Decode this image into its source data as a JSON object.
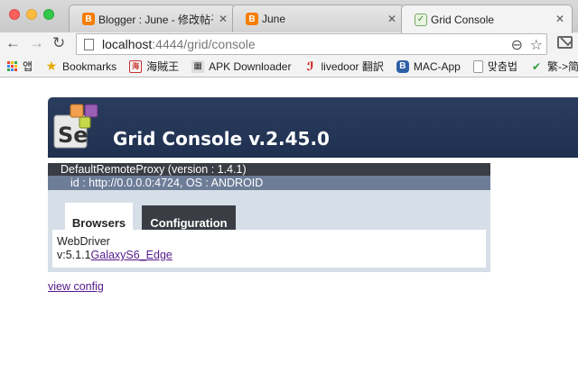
{
  "browser": {
    "tabs": [
      {
        "label": "Blogger : June - 修改帖子",
        "favicon": "blogger-icon"
      },
      {
        "label": "June",
        "favicon": "blogger-icon"
      },
      {
        "label": "Grid Console",
        "favicon": "grid-console-icon",
        "active": true
      }
    ],
    "url_host": "localhost",
    "url_path": ":4444/grid/console",
    "bookmarks": [
      {
        "label": "앱",
        "icon": "apps-icon"
      },
      {
        "label": "Bookmarks",
        "icon": "star-icon"
      },
      {
        "label": "海賊王",
        "icon": "bookmark-icon"
      },
      {
        "label": "APK Downloader",
        "icon": "android-icon"
      },
      {
        "label": "livedoor 翻訳",
        "icon": "livedoor-icon"
      },
      {
        "label": "MAC-App",
        "icon": "b-icon"
      },
      {
        "label": "맞춤법",
        "icon": "page-icon"
      },
      {
        "label": "繁->简",
        "icon": "hao-icon"
      }
    ]
  },
  "page": {
    "header_title": "Grid Console v.2.45.0",
    "logo_text": "Se",
    "proxy": {
      "title": "DefaultRemoteProxy (version : 1.4.1)",
      "subtitle": "id : http://0.0.0.0:4724, OS : ANDROID",
      "tabs": [
        "Browsers",
        "Configuration"
      ],
      "content_line1": "WebDriver",
      "content_prefix": "v:5.1.1",
      "content_link": "GalaxyS6_Edge"
    },
    "view_config": "view config"
  },
  "colors": {
    "header_bg": "#23355a",
    "proxy_header_dark": "#3a3d44",
    "proxy_header_mid": "#6d7d98",
    "proxy_body": "#d6dfe8",
    "link": "#551a8b"
  }
}
